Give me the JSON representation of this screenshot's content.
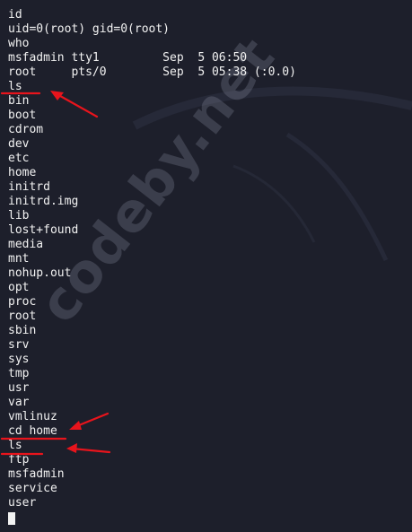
{
  "terminal": {
    "lines": [
      "id",
      "uid=0(root) gid=0(root)",
      "who",
      "msfadmin tty1         Sep  5 06:50",
      "root     pts/0        Sep  5 05:38 (:0.0)",
      "ls",
      "bin",
      "boot",
      "cdrom",
      "dev",
      "etc",
      "home",
      "initrd",
      "initrd.img",
      "lib",
      "lost+found",
      "media",
      "mnt",
      "nohup.out",
      "opt",
      "proc",
      "root",
      "sbin",
      "srv",
      "sys",
      "tmp",
      "usr",
      "var",
      "vmlinuz",
      "cd home",
      "ls",
      "ftp",
      "msfadmin",
      "service",
      "user"
    ]
  },
  "watermark": {
    "text": "codeby.net"
  },
  "colors": {
    "background": "#1d1f2b",
    "text": "#f2f2f2",
    "annotation": "#e8141c"
  }
}
